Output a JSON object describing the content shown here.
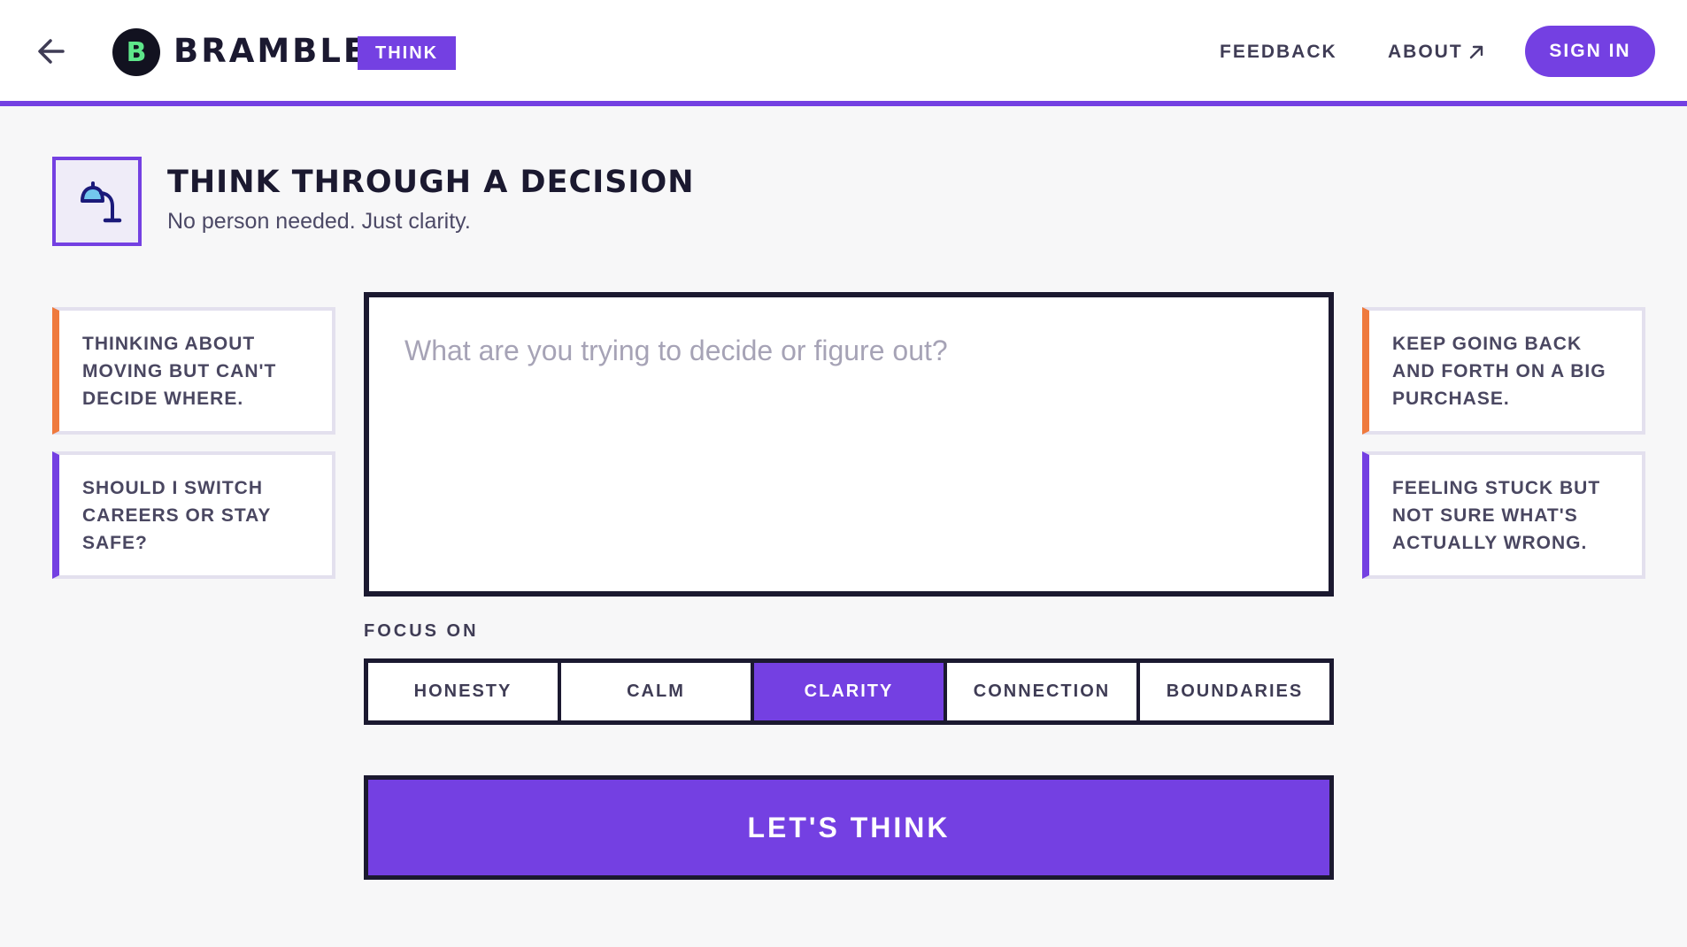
{
  "header": {
    "logo_letter": "B",
    "brand": "BRAMBLE",
    "mode_badge": "THINK",
    "nav": {
      "feedback": "FEEDBACK",
      "about": "ABOUT",
      "sign_in": "SIGN IN"
    }
  },
  "page": {
    "title": "THINK THROUGH A DECISION",
    "subtitle": "No person needed. Just clarity."
  },
  "suggestions": {
    "left": [
      {
        "text": "THINKING ABOUT MOVING BUT CAN'T DECIDE WHERE.",
        "accent": "#ef7a3d"
      },
      {
        "text": "SHOULD I SWITCH CAREERS OR STAY SAFE?",
        "accent": "#7440e2"
      }
    ],
    "right": [
      {
        "text": "KEEP GOING BACK AND FORTH ON A BIG PURCHASE.",
        "accent": "#ef7a3d"
      },
      {
        "text": "FEELING STUCK BUT NOT SURE WHAT'S ACTUALLY WRONG.",
        "accent": "#7440e2"
      }
    ]
  },
  "prompt": {
    "placeholder": "What are you trying to decide or figure out?",
    "value": ""
  },
  "focus": {
    "label": "FOCUS ON",
    "options": [
      "HONESTY",
      "CALM",
      "CLARITY",
      "CONNECTION",
      "BOUNDARIES"
    ],
    "selected": "CLARITY"
  },
  "submit_label": "LET'S THINK",
  "colors": {
    "accent": "#7440e2",
    "secondary_accent": "#ef7a3d",
    "ink": "#1b1930",
    "logo_letter": "#5ee68a"
  },
  "icons": {
    "back": "arrow-left-icon",
    "about_external": "arrow-up-right-icon",
    "title": "desk-lamp-icon"
  }
}
